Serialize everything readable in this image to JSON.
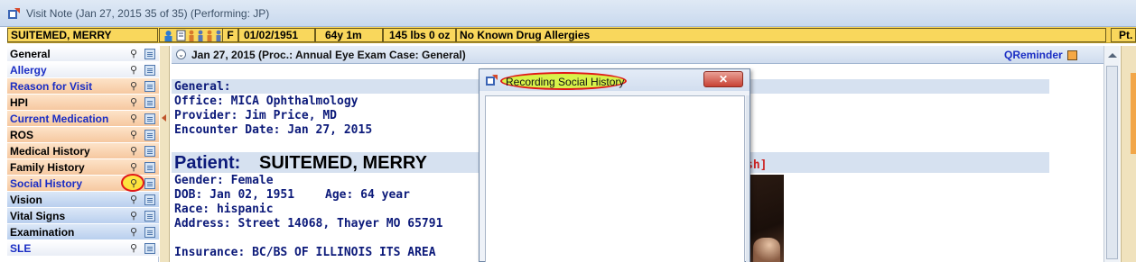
{
  "window": {
    "title": "Visit Note (Jan 27, 2015   35 of 35) (Performing: JP)"
  },
  "banner": {
    "patient_name": "SUITEMED, MERRY",
    "gender": "F",
    "dob": "01/02/1951",
    "age": "64y 1m",
    "weight": "145 lbs 0 oz",
    "allergies": "No Known Drug Allergies",
    "right_label": "Pt."
  },
  "sidebar": {
    "items": [
      {
        "label": "General",
        "style": "white-black"
      },
      {
        "label": "Allergy",
        "style": "white-blue"
      },
      {
        "label": "Reason for Visit",
        "style": "peach-blue"
      },
      {
        "label": "HPI",
        "style": "peach-black"
      },
      {
        "label": "Current Medication",
        "style": "peach-blue"
      },
      {
        "label": "ROS",
        "style": "peach-black"
      },
      {
        "label": "Medical History",
        "style": "peach-black"
      },
      {
        "label": "Family History",
        "style": "peach-black"
      },
      {
        "label": "Social History",
        "style": "peach-blue"
      },
      {
        "label": "Vision",
        "style": "blue-black"
      },
      {
        "label": "Vital Signs",
        "style": "blue-black"
      },
      {
        "label": "Examination",
        "style": "blue-black"
      },
      {
        "label": "SLE",
        "style": "white-blue"
      }
    ]
  },
  "docbar": {
    "encounter": "Jan 27, 2015  (Proc.: Annual Eye Exam  Case: General)",
    "qreminder": "QReminder"
  },
  "document": {
    "general_heading": "General:",
    "office": "Office: MICA Ophthalmology",
    "provider": "Provider: Jim Price, MD",
    "encounter_date": "Encounter Date: Jan 27, 2015",
    "patient_label": "Patient:",
    "patient_name": "SUITEMED, MERRY",
    "partial_red": "sh]",
    "gender": "Gender: Female",
    "dob": "DOB: Jan 02, 1951",
    "age": "Age: 64 year",
    "race": "Race: hispanic",
    "address": "Address: Street 14068, Thayer MO  65791",
    "insurance": "Insurance: BC/BS OF ILLINOIS ITS AREA"
  },
  "dialog": {
    "title": "Recording Social History",
    "close_label": "✕"
  },
  "colors": {
    "banner": "#f7d257",
    "nav_peach": "#f6c8a0",
    "nav_blue": "#b9cfee",
    "link_blue": "#1a2dc4",
    "navy_text": "#0c1a7a",
    "highlight_red": "#e01818",
    "highlight_yellow": "#d7f24a"
  }
}
